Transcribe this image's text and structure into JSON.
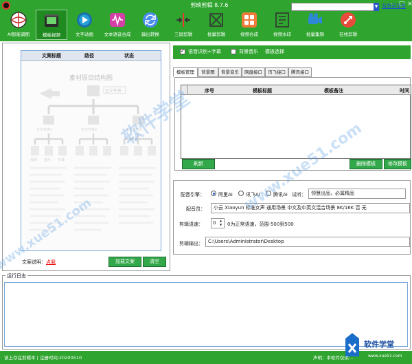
{
  "app": {
    "title": "剪映剪辑 8.7.6"
  },
  "toolbar": [
    {
      "label": "AI智能调图",
      "icon": "ai-ball-icon",
      "active": false
    },
    {
      "label": "模板视频",
      "icon": "template-film-icon",
      "active": true
    },
    {
      "label": "文字动画",
      "icon": "play-circle-icon",
      "active": false
    },
    {
      "label": "文本语音合成",
      "icon": "audio-wave-icon",
      "active": false
    },
    {
      "label": "输出转换",
      "icon": "convert-arrows-icon",
      "active": false
    },
    {
      "label": "三屏剪辑",
      "icon": "split-screen-icon",
      "active": false
    },
    {
      "label": "批量剪辑",
      "icon": "batch-cut-icon",
      "active": false
    },
    {
      "label": "视频合成",
      "icon": "grid-merge-icon",
      "active": false
    },
    {
      "label": "视频水印",
      "icon": "watermark-icon",
      "active": false
    },
    {
      "label": "批量集锦",
      "icon": "camera-batch-icon",
      "active": false
    },
    {
      "label": "在线剪辑",
      "icon": "rocket-icon",
      "active": false
    }
  ],
  "left_table": {
    "headers": [
      "文案标题",
      "路径",
      "状态"
    ]
  },
  "diagram": {
    "title": "素材原目结构图",
    "root_label": "主文件夹",
    "branches": [
      "主文件夹1",
      "主文件夹2",
      "主文件夹3"
    ],
    "leaf_tags": [
      "视频",
      "音乐",
      "字幕"
    ]
  },
  "copy_note": {
    "label": "文案说明：",
    "link": "点我"
  },
  "left_buttons": {
    "load": "加载文案",
    "clear": "清空"
  },
  "top_options": {
    "opt1": "语音识别+字幕",
    "opt2": "背景音乐",
    "opt3": "模板选择",
    "link": "背景音背景"
  },
  "tabs": [
    "模板管理",
    "背景图",
    "背景音乐",
    "网盘接口",
    "讯飞接口",
    "腾讯接口"
  ],
  "template_table": {
    "headers": [
      "序号",
      "模板标题",
      "模板备注",
      "时间"
    ]
  },
  "template_buttons": {
    "refresh": "刷新",
    "delete": "删除模板",
    "modify": "修改模板"
  },
  "voice": {
    "engine_label": "配音引擎：",
    "engines": [
      "阿里AI",
      "讯飞AI",
      "腾讯AI"
    ],
    "listen_label": "试听：",
    "listen_text": "领慧出品，必属精品",
    "voicer_label": "配音员：",
    "voicer_value": "小云 Xiaoyun 标准女声 通用场景 中文及中英文混合场景 8K/16K 否 无",
    "speed_label": "剪辑语速：",
    "speed_value": "0",
    "speed_hint": "0为正常语速，范围-500到500",
    "output_label": "剪辑输出：",
    "output_path": "C:\\Users\\Administrator\\Desktop"
  },
  "log": {
    "legend": "运行日志"
  },
  "status": {
    "left": "该上存在剪辑本 | 注册时间:20200510",
    "right": "声明：本软件仅供..."
  },
  "watermark": {
    "brand": "软件学堂",
    "url": "www.xue51.com"
  },
  "colors": {
    "green": "#2fa52f",
    "link_blue": "#1b4fd6",
    "accent_red": "#e00000"
  }
}
